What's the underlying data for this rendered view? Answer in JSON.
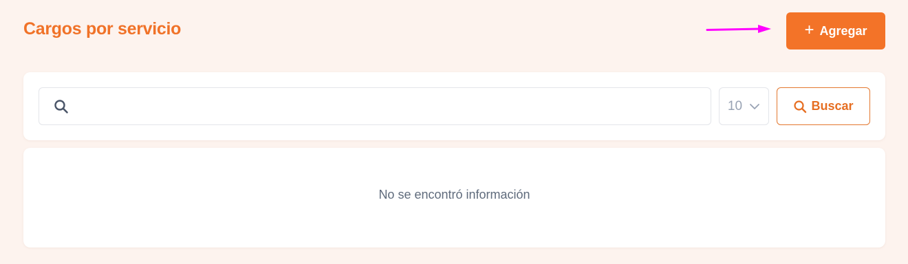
{
  "header": {
    "title": "Cargos por servicio",
    "add_button_label": "Agregar"
  },
  "search": {
    "value": "",
    "placeholder": ""
  },
  "page_size": {
    "selected": "10"
  },
  "search_button_label": "Buscar",
  "results": {
    "empty_message": "No se encontró información"
  },
  "colors": {
    "accent": "#f37328",
    "background": "#fdf3ee",
    "annotation_arrow": "#ff00ff"
  },
  "icons": [
    "search-icon",
    "plus-icon",
    "chevron-down-icon",
    "annotation-arrow"
  ]
}
